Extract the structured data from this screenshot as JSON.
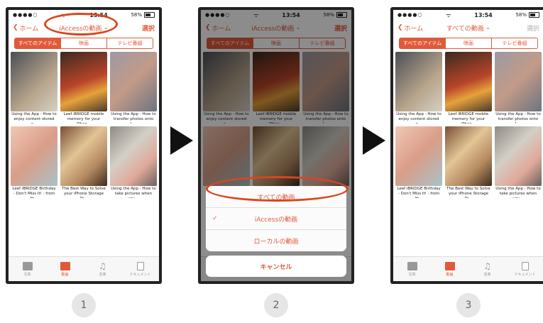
{
  "status": {
    "signal": "●●●●○",
    "wifi": "ᯤ",
    "time": "13:54",
    "battery_pct": "58%"
  },
  "nav": {
    "back_label": "ホーム",
    "title_phone1": "iAccessの動画",
    "title_phone3": "すべての動画",
    "select_label": "選択"
  },
  "segments": [
    "すべてのアイテム",
    "映画",
    "テレビ番組"
  ],
  "videos": [
    {
      "caption": "Using the App - How to enjoy content stored o..."
    },
    {
      "caption": "Leef iBRIDGE mobile memory for your iPhon..."
    },
    {
      "caption": "Using the App - How to transfer photos onto L..."
    },
    {
      "caption": "Leef iBRIDGE Birthday - Don't Miss It! - from Yo..."
    },
    {
      "caption": "The Best Way to Solve your iPhone Storage Pr..."
    },
    {
      "caption": "Using the App - How to take pictures when you..."
    }
  ],
  "tabs": [
    "写真",
    "動画",
    "音楽",
    "ドキュメント"
  ],
  "action_sheet": {
    "option_all": "すべての動画",
    "option_iaccess": "iAccessの動画",
    "option_local": "ローカルの動画",
    "cancel": "キャンセル",
    "checkmark": "✓"
  },
  "steps": [
    "1",
    "2",
    "3"
  ],
  "colors": {
    "accent": "#e05a3a",
    "annotation": "#d9461e"
  }
}
